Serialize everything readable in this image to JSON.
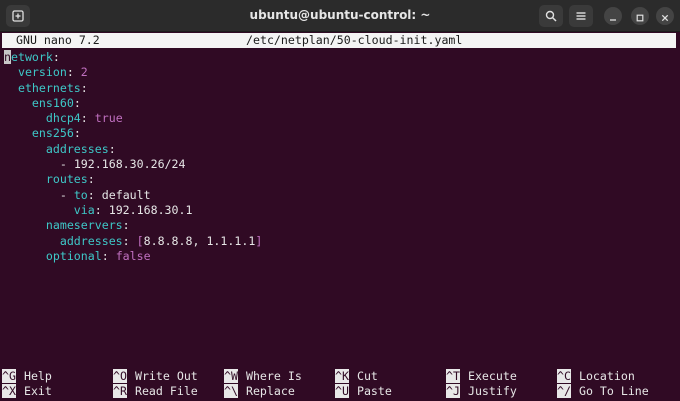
{
  "window": {
    "title": "ubuntu@ubuntu-control: ~"
  },
  "nano": {
    "version_label": "GNU nano 7.2",
    "file_path": "/etc/netplan/50-cloud-init.yaml"
  },
  "editor": {
    "lines": [
      [
        {
          "t": "network",
          "c": "k",
          "cursor_first": true
        },
        {
          "t": ":",
          "c": "p"
        }
      ],
      [
        {
          "t": "  version",
          "c": "k"
        },
        {
          "t": ": ",
          "c": "p"
        },
        {
          "t": "2",
          "c": "b"
        }
      ],
      [
        {
          "t": "  ethernets",
          "c": "k"
        },
        {
          "t": ":",
          "c": "p"
        }
      ],
      [
        {
          "t": "    ens160",
          "c": "k"
        },
        {
          "t": ":",
          "c": "p"
        }
      ],
      [
        {
          "t": "      dhcp4",
          "c": "k"
        },
        {
          "t": ": ",
          "c": "p"
        },
        {
          "t": "true",
          "c": "b"
        }
      ],
      [
        {
          "t": "    ens256",
          "c": "k"
        },
        {
          "t": ":",
          "c": "p"
        }
      ],
      [
        {
          "t": "      addresses",
          "c": "k"
        },
        {
          "t": ":",
          "c": "p"
        }
      ],
      [
        {
          "t": "        - ",
          "c": "p"
        },
        {
          "t": "192.168.30.26/24",
          "c": "v"
        }
      ],
      [
        {
          "t": "      routes",
          "c": "k"
        },
        {
          "t": ":",
          "c": "p"
        }
      ],
      [
        {
          "t": "        - ",
          "c": "p"
        },
        {
          "t": "to",
          "c": "k"
        },
        {
          "t": ": ",
          "c": "p"
        },
        {
          "t": "default",
          "c": "v"
        }
      ],
      [
        {
          "t": "          via",
          "c": "k"
        },
        {
          "t": ": ",
          "c": "p"
        },
        {
          "t": "192.168.30.1",
          "c": "v"
        }
      ],
      [
        {
          "t": "      nameservers",
          "c": "k"
        },
        {
          "t": ":",
          "c": "p"
        }
      ],
      [
        {
          "t": "        addresses",
          "c": "k"
        },
        {
          "t": ": ",
          "c": "p"
        },
        {
          "t": "[",
          "c": "b"
        },
        {
          "t": "8.8.8.8, 1.1.1.1",
          "c": "v"
        },
        {
          "t": "]",
          "c": "b"
        }
      ],
      [
        {
          "t": "      optional",
          "c": "k"
        },
        {
          "t": ": ",
          "c": "p"
        },
        {
          "t": "false",
          "c": "b"
        }
      ]
    ]
  },
  "shortcuts": {
    "row1": [
      {
        "key": "^G",
        "label": "Help"
      },
      {
        "key": "^O",
        "label": "Write Out"
      },
      {
        "key": "^W",
        "label": "Where Is"
      },
      {
        "key": "^K",
        "label": "Cut"
      },
      {
        "key": "^T",
        "label": "Execute"
      },
      {
        "key": "^C",
        "label": "Location"
      }
    ],
    "row2": [
      {
        "key": "^X",
        "label": "Exit"
      },
      {
        "key": "^R",
        "label": "Read File"
      },
      {
        "key": "^\\",
        "label": "Replace"
      },
      {
        "key": "^U",
        "label": "Paste"
      },
      {
        "key": "^J",
        "label": "Justify"
      },
      {
        "key": "^/",
        "label": "Go To Line"
      }
    ]
  },
  "colors": {
    "terminal_bg": "#300a24",
    "key_color": "#3ec8c8",
    "literal_color": "#c070c0",
    "titlebar_bg": "#2b2b2b"
  },
  "icons": {
    "new_tab": "new-tab-icon",
    "search": "search-icon",
    "menu": "hamburger-menu-icon",
    "minimize": "minimize-icon",
    "maximize": "maximize-icon",
    "close": "close-icon"
  }
}
